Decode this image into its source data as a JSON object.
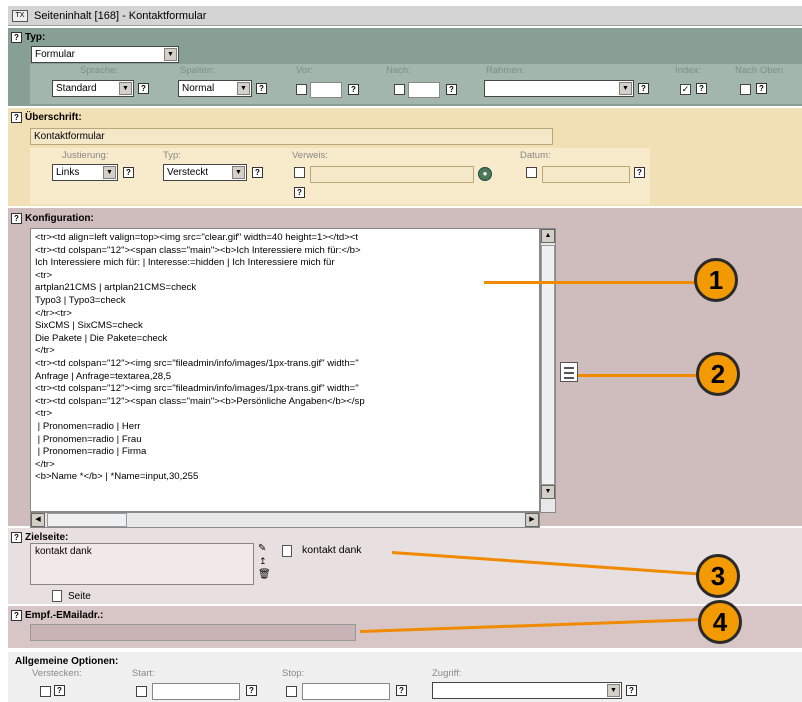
{
  "window": {
    "title": "Seiteninhalt [168] - Kontaktformular"
  },
  "typ_section": {
    "header": "Typ:",
    "type_value": "Formular",
    "labels": {
      "sprache": "Sprache:",
      "spalten": "Spalten:",
      "vor": "Vor:",
      "nach": "Nach:",
      "rahmen": "Rahmen:",
      "index": "Index:",
      "nach_oben": "Nach Oben"
    },
    "sprache_value": "Standard",
    "spalten_value": "Normal",
    "rahmen_value": "",
    "index_checked": true,
    "nach_oben_checked": false
  },
  "ueberschrift": {
    "header": "Überschrift:",
    "value": "Kontaktformular",
    "labels": {
      "justierung": "Justierung:",
      "typ": "Typ:",
      "verweis": "Verweis:",
      "datum": "Datum:"
    },
    "justierung_value": "Links",
    "typ_value": "Versteckt"
  },
  "konfiguration": {
    "header": "Konfiguration:",
    "lines": [
      "<tr><td align=left valign=top><img src=\"clear.gif\" width=40 height=1></td><t",
      "<tr><td colspan=\"12\"><span class=\"main\"><b>Ich Interessiere mich für:</b>",
      "Ich Interessiere mich für: | Interesse:=hidden | Ich Interessiere mich für",
      "<tr>",
      "artplan21CMS | artplan21CMS=check",
      "Typo3 | Typo3=check",
      "</tr><tr>",
      "SixCMS | SixCMS=check",
      "Die Pakete | Die Pakete=check",
      "</tr>",
      "<tr><td colspan=\"12\"><img src=\"fileadmin/info/images/1px-trans.gif\" width=\"",
      "Anfrage | Anfrage=textarea,28,5",
      "<tr><td colspan=\"12\"><img src=\"fileadmin/info/images/1px-trans.gif\" width=\"",
      "<tr><td colspan=\"12\"><span class=\"main\"><b>Persönliche Angaben</b></sp",
      "<tr>",
      " | Pronomen=radio | Herr",
      " | Pronomen=radio | Frau",
      " | Pronomen=radio | Firma",
      "</tr>",
      "<b>Name *</b> | *Name=input,30,255"
    ]
  },
  "zielseite": {
    "header": "Zielseite:",
    "list_value": "kontakt dank",
    "selected_page": "kontakt dank",
    "browse_label": "Seite"
  },
  "empf": {
    "header": "Empf.-EMailadr.:",
    "value": ""
  },
  "allgemein": {
    "header": "Allgemeine Optionen:",
    "labels": {
      "verstecken": "Verstecken:",
      "start": "Start:",
      "stop": "Stop:",
      "zugriff": "Zugriff:"
    },
    "zugriff_value": ""
  },
  "callouts": [
    "1",
    "2",
    "3",
    "4"
  ],
  "colors": {
    "typ_bg": "#889f94",
    "typ_inner": "#a3b6ac",
    "head_bg": "#f1e0b5",
    "konf_bg": "#cfbcbc",
    "option_bg": "#f0f0f0",
    "accent": "#f39a00"
  },
  "icons": {
    "help": "help-icon",
    "page": "page-icon",
    "globe": "link-browser-icon",
    "wizard": "form-wizard-icon"
  }
}
